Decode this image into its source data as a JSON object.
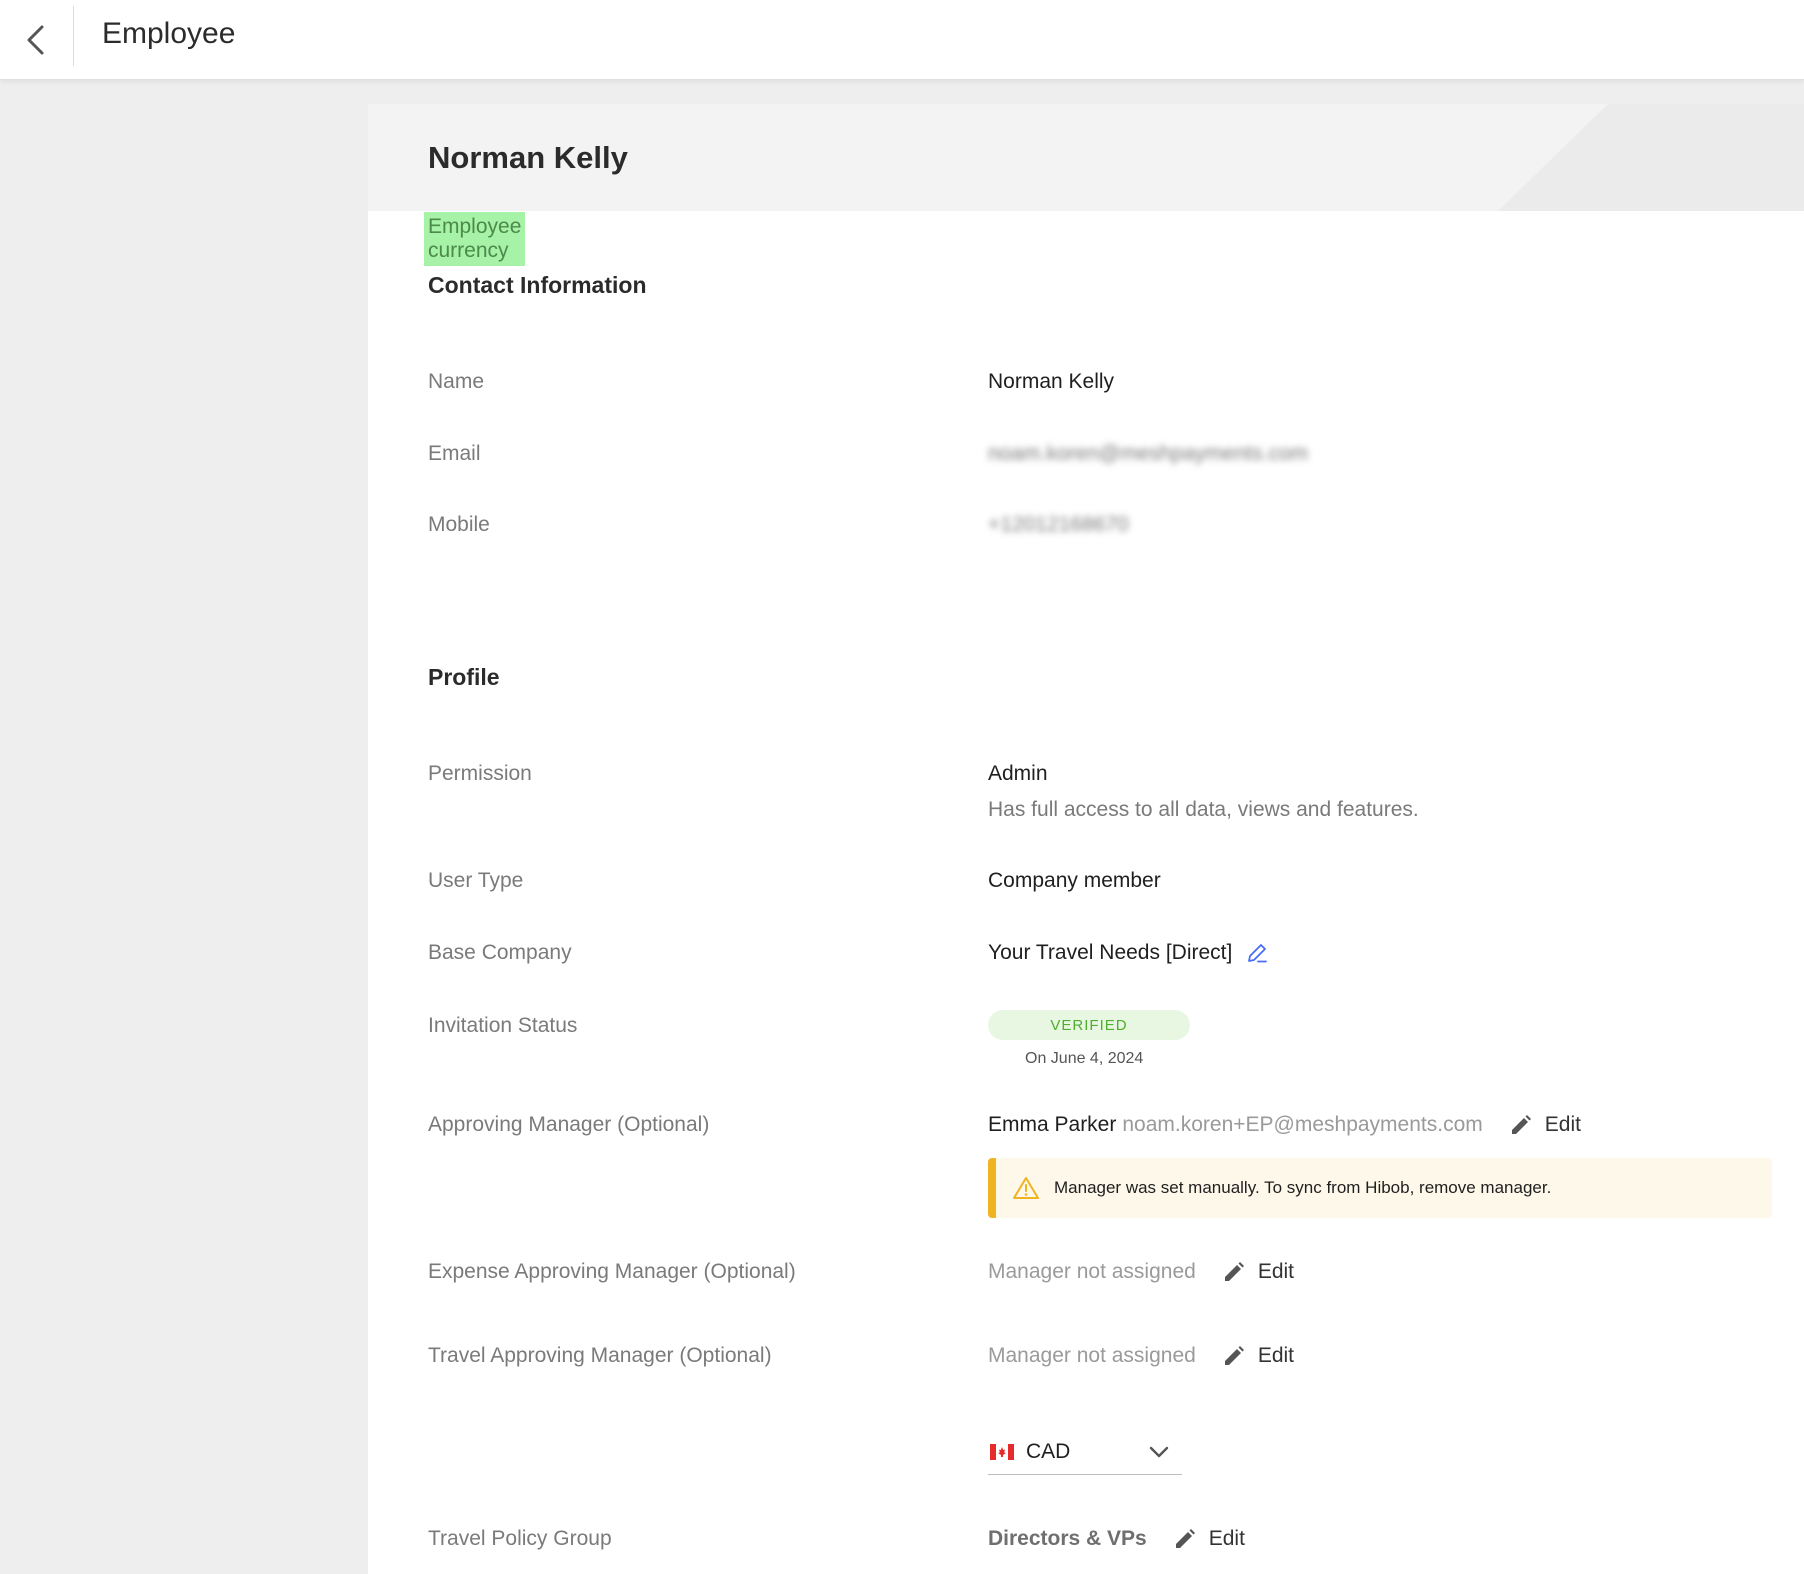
{
  "header": {
    "title": "Employee"
  },
  "employee": {
    "name": "Norman Kelly"
  },
  "contact": {
    "section_title": "Contact Information",
    "name_label": "Name",
    "name_value": "Norman Kelly",
    "email_label": "Email",
    "email_value": "noam.koren@meshpayments.com",
    "mobile_label": "Mobile",
    "mobile_value": "+12012168670"
  },
  "profile": {
    "section_title": "Profile",
    "permission_label": "Permission",
    "permission_value": "Admin",
    "permission_desc": "Has full access to all data, views and features.",
    "user_type_label": "User Type",
    "user_type_value": "Company member",
    "base_company_label": "Base Company",
    "base_company_value": "Your Travel Needs [Direct]",
    "invitation_label": "Invitation Status",
    "invitation_badge": "VERIFIED",
    "invitation_date": "On June 4, 2024",
    "approving_label": "Approving Manager (Optional)",
    "approving_name": "Emma Parker",
    "approving_email": "noam.koren+EP@meshpayments.com",
    "edit_label": "Edit",
    "warning_text": "Manager was set manually. To sync from Hibob, remove manager.",
    "expense_label": "Expense Approving Manager (Optional)",
    "expense_value": "Manager not assigned",
    "travel_label": "Travel Approving Manager (Optional)",
    "travel_value": "Manager not assigned",
    "currency_label": "Employee currency",
    "currency_value": "CAD",
    "policy_label": "Travel Policy Group",
    "policy_value": "Directors & VPs"
  },
  "colors": {
    "verified_green": "#4fae2c",
    "warning_yellow": "#f0b322",
    "highlight_green": "#a6f2a6",
    "link_blue": "#4a6cf7"
  },
  "icons": {
    "back": "chevron-left-icon",
    "edit": "pencil-icon",
    "warning": "warning-triangle-icon",
    "flag": "canada-flag-icon",
    "dropdown": "chevron-down-icon"
  }
}
